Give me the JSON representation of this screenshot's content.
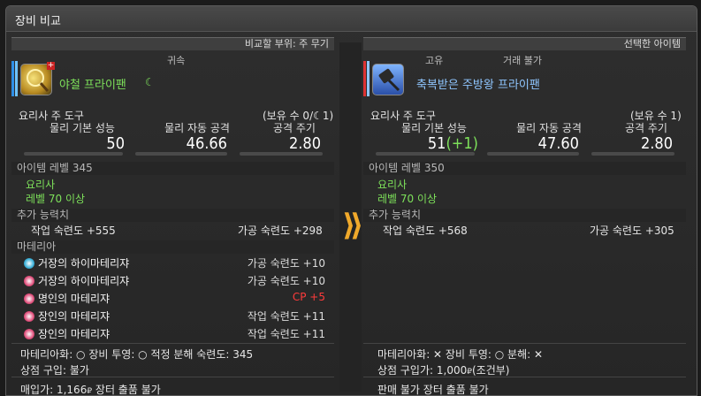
{
  "window": {
    "title": "장비 비교"
  },
  "left": {
    "header": "비교할 부위: 주 무기",
    "tag": "귀속",
    "item_name": "야철 프라이팬",
    "category": "요리사 주 도구",
    "owned": "(보유 수 0/",
    "owned_suffix": "1)",
    "stat_labels": [
      "물리 기본 성능",
      "물리 자동 공격",
      "공격 주기"
    ],
    "stat_values": [
      "50",
      "46.66",
      "2.80"
    ],
    "item_level": "아이템 레벨 345",
    "job": "요리사",
    "level_req": "레벨 70 이상",
    "bonus_title": "추가 능력치",
    "bonus1": "작업 숙련도 +555",
    "bonus2": "가공 숙련도 +298",
    "materia_title": "마테리아",
    "materia": [
      {
        "name": "거장의 하이마테리쟈",
        "value": "가공 숙련도 +10"
      },
      {
        "name": "거장의 하이마테리쟈",
        "value": "가공 숙련도 +10"
      },
      {
        "name": "명인의 마테리쟈",
        "value": "CP +5"
      },
      {
        "name": "장인의 마테리쟈",
        "value": "작업 숙련도 +11"
      },
      {
        "name": "장인의 마테리쟈",
        "value": "작업 숙련도 +11"
      }
    ],
    "footer1": "마테리아화: ○  장비 투영: ○  적정 분해 숙련도: 345",
    "footer2": "상점 구입: 불가",
    "footer3": "매입가: 1,166",
    "footer3b": "장터 출품 불가"
  },
  "right": {
    "header": "선택한 아이템",
    "tag1": "고유",
    "tag2": "거래 불가",
    "item_name": "축복받은 주방왕 프라이팬",
    "category": "요리사 주 도구",
    "owned": "(보유 수 1)",
    "stat_labels": [
      "물리 기본 성능",
      "물리 자동 공격",
      "공격 주기"
    ],
    "stat_values": [
      "51",
      "47.60",
      "2.80"
    ],
    "stat_diff": "(+1)",
    "item_level": "아이템 레벨 350",
    "job": "요리사",
    "level_req": "레벨 70 이상",
    "bonus_title": "추가 능력치",
    "bonus1": "작업 숙련도 +568",
    "bonus2": "가공 숙련도 +305",
    "footer1": "마테리아화: ✕  장비 투영: ○  분해: ✕",
    "footer2": "상점 구입가: 1,000",
    "footer2b": "(조건부)",
    "footer3": "판매 불가 장터 출품 불가"
  },
  "colors": {
    "accent_arrow": "#f0a92b",
    "green": "#7de05a",
    "red": "#ff3b3b"
  }
}
